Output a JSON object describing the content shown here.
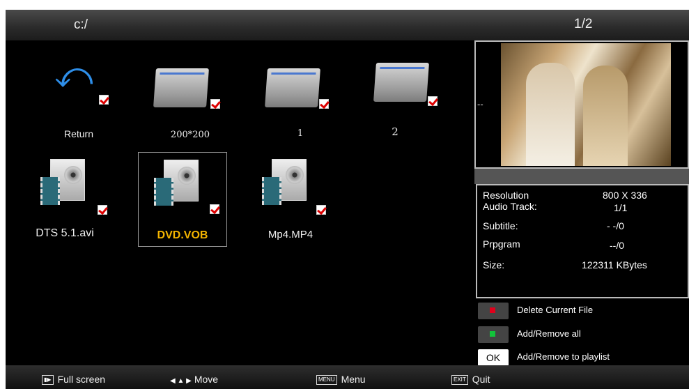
{
  "header": {
    "path": "c:/",
    "page": "1/2"
  },
  "files": [
    {
      "label": "Return",
      "type": "return",
      "checked": true,
      "icon": "return-arrow-icon"
    },
    {
      "label": "200*200",
      "type": "folder",
      "checked": true,
      "icon": "folder-icon"
    },
    {
      "label": "1",
      "type": "folder",
      "checked": true,
      "icon": "folder-icon"
    },
    {
      "label": "2",
      "type": "folder",
      "checked": true,
      "icon": "folder-icon"
    },
    {
      "label": "DTS 5.1.avi",
      "type": "video",
      "checked": true,
      "icon": "dvd-video-icon"
    },
    {
      "label": "DVD.VOB",
      "type": "video",
      "checked": true,
      "selected": true,
      "icon": "dvd-video-icon"
    },
    {
      "label": "Mp4.MP4",
      "type": "video",
      "checked": true,
      "icon": "dvd-video-icon"
    }
  ],
  "preview": {
    "side_label": "--"
  },
  "info": {
    "resolution_label": "Resolution",
    "resolution_value": "800 X 336",
    "audio_label": "Audio Track:",
    "audio_value": "1/1",
    "subtitle_label": "Subtitle:",
    "subtitle_value": "- -/0",
    "program_label": "Prpgram",
    "program_value": "--/0",
    "size_label": "Size:",
    "size_value": "122311 KBytes"
  },
  "actions": [
    {
      "label": "Delete Current File",
      "key": "red",
      "color": "#e0001b"
    },
    {
      "label": "Add/Remove all",
      "key": "green",
      "color": "#12c23a"
    },
    {
      "label": "Add/Remove to playlist",
      "key": "OK"
    }
  ],
  "hints": {
    "fullscreen": "Full screen",
    "fullscreen_key": "▮▶",
    "move": "Move",
    "menu": "Menu",
    "menu_key": "MENU",
    "quit": "Quit",
    "quit_key": "EXIT"
  },
  "colors": {
    "selected_text": "#f3b400",
    "check": "#d00000",
    "return_arrow": "#2e8ee8"
  }
}
